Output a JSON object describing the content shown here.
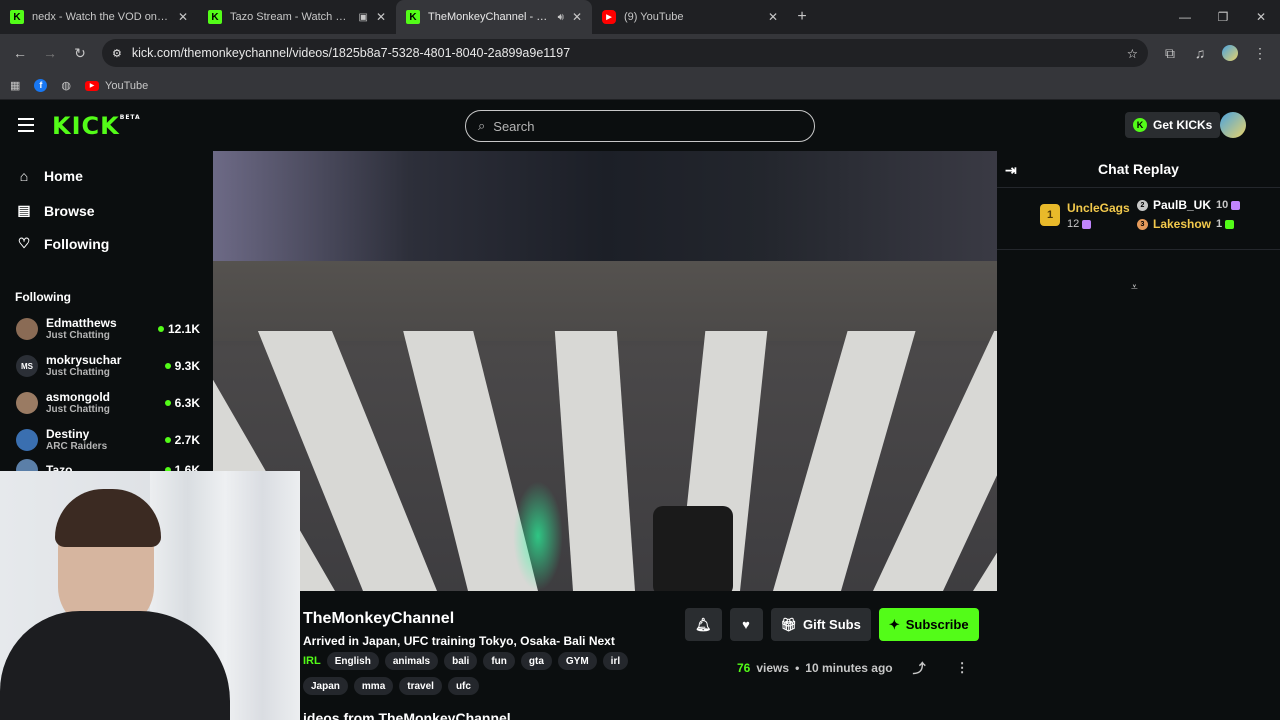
{
  "browser": {
    "tabs": [
      {
        "title": "nedx - Watch the VOD on Kick",
        "icon": "kick-favicon",
        "active": false
      },
      {
        "title": "Tazo Stream - Watch Live on Kick",
        "icon": "kick-favicon",
        "active": false
      },
      {
        "title": "TheMonkeyChannel - Watch VOD",
        "icon": "kick-favicon",
        "active": true
      },
      {
        "title": "(9) YouTube",
        "icon": "youtube-favicon",
        "active": false
      }
    ],
    "url": "kick.com/themonkeychannel/videos/1825b8a7-5328-4801-8040-2a899a9e1197",
    "bookmarks": [
      {
        "label": "",
        "icon": "apps-grid-icon"
      },
      {
        "label": "",
        "icon": "facebook-icon"
      },
      {
        "label": "",
        "icon": "globe-icon"
      },
      {
        "label": "YouTube",
        "icon": "youtube-icon"
      }
    ]
  },
  "header": {
    "logo": "KICK",
    "logo_badge": "BETA",
    "search_placeholder": "Search",
    "get_kicks_label": "Get KICKs"
  },
  "sidebar": {
    "nav": [
      {
        "label": "Home",
        "icon": "home-icon"
      },
      {
        "label": "Browse",
        "icon": "browse-icon"
      },
      {
        "label": "Following",
        "icon": "heart-icon"
      }
    ],
    "following_title": "Following",
    "channels": [
      {
        "name": "Edmatthews",
        "category": "Just Chatting",
        "viewers": "12.1K",
        "avatar_text": "",
        "avatar_color": "#8a6b55"
      },
      {
        "name": "mokrysuchar",
        "category": "Just Chatting",
        "viewers": "9.3K",
        "avatar_text": "MS",
        "avatar_color": "#2b2f36"
      },
      {
        "name": "asmongold",
        "category": "Just Chatting",
        "viewers": "6.3K",
        "avatar_text": "",
        "avatar_color": "#9a7b63"
      },
      {
        "name": "Destiny",
        "category": "ARC Raiders",
        "viewers": "2.7K",
        "avatar_text": "",
        "avatar_color": "#3a6fb0"
      },
      {
        "name": "Tazo",
        "category": "",
        "viewers": "1.6K",
        "avatar_text": "",
        "avatar_color": "#5b7fa8"
      }
    ]
  },
  "video": {
    "channel_name": "TheMonkeyChannel",
    "title": "Arrived in Japan, UFC training Tokyo, Osaka- Bali Next",
    "category": "IRL",
    "tags": [
      "English",
      "animals",
      "bali",
      "fun",
      "gta",
      "GYM",
      "irl",
      "Japan",
      "mma",
      "travel",
      "ufc"
    ],
    "gift_subs_label": "Gift Subs",
    "subscribe_label": "Subscribe",
    "views_count": "76",
    "views_label": "views",
    "separator": "•",
    "time_ago": "10 minutes ago",
    "more_from_label": "ideos from TheMonkeyChannel"
  },
  "chat": {
    "title": "Chat Replay",
    "top_gifter": {
      "rank": "1",
      "name": "UncleGags",
      "count": "12"
    },
    "gifters": [
      {
        "rank": "2",
        "name": "PaulB_UK",
        "count": "10",
        "rank_color": "#c7c7c7",
        "name_color": "#ffffff"
      },
      {
        "rank": "3",
        "name": "Lakeshow",
        "count": "1",
        "rank_color": "#e59a5a",
        "name_color": "#f2c94c"
      }
    ]
  },
  "colors": {
    "accent": "#53fc18",
    "background": "#0b0e0f"
  }
}
